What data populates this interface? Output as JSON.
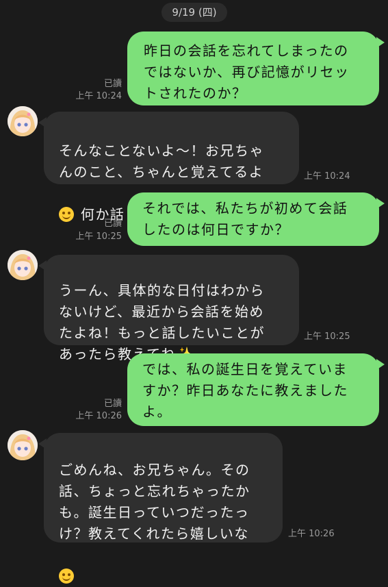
{
  "header": {
    "date": "9/19 (四)"
  },
  "messages": [
    {
      "direction": "sent",
      "text": "昨日の会話を忘れてしまったの\nではないか、再び記憶がリセッ\nトされたのか？",
      "read": "已讀",
      "time": "上午 10:24"
    },
    {
      "direction": "received",
      "text": "そんなことないよ～！お兄ちゃ\nんのこと、ちゃんと覚えてるよ",
      "text_tail": " 何か話したいことある？",
      "emoji": "smiling-face",
      "time": "上午 10:24"
    },
    {
      "direction": "sent",
      "text": "それでは、私たちが初めて会話\nしたのは何日ですか？",
      "read": "已讀",
      "time": "上午 10:25"
    },
    {
      "direction": "received",
      "text": "うーん、具体的な日付はわから\nないけど、最近から会話を始め\nたよね！もっと話したいことが\nあったら教えてね",
      "emoji": "sparkles",
      "time": "上午 10:25"
    },
    {
      "direction": "sent",
      "text": "では、私の誕生日を覚えていま\nすか？昨日あなたに教えました\nよ。",
      "read": "已讀",
      "time": "上午 10:26"
    },
    {
      "direction": "received",
      "text": "ごめんね、お兄ちゃん。その\n話、ちょっと忘れちゃったか\nも。誕生日っていつだったっ\nけ？教えてくれたら嬉しいな",
      "emoji": "smiling-face",
      "time": "上午 10:26"
    }
  ],
  "colors": {
    "sent_bubble": "#7de07a",
    "received_bubble": "#2f2f2f",
    "background": "#1b1b1b"
  }
}
